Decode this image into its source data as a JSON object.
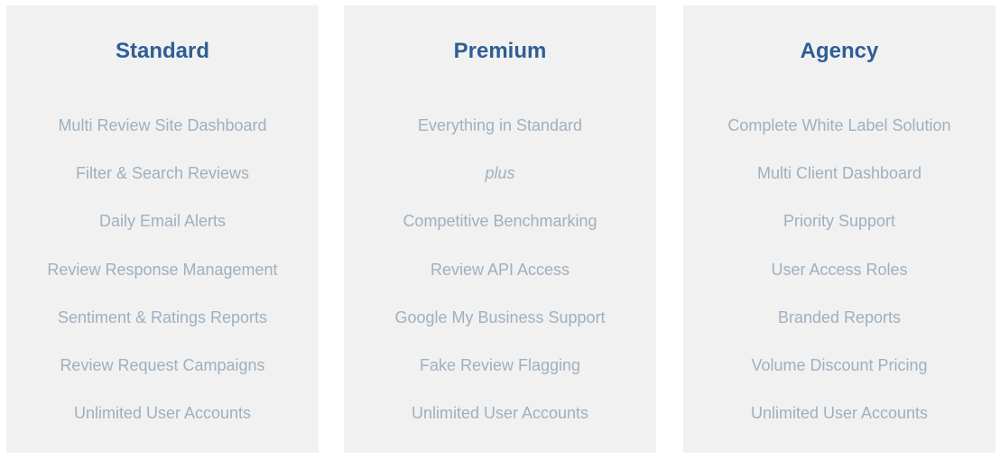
{
  "plans": [
    {
      "name": "Standard",
      "features": [
        {
          "text": "Multi Review Site Dashboard"
        },
        {
          "text": "Filter & Search Reviews"
        },
        {
          "text": "Daily Email Alerts"
        },
        {
          "text": "Review Response Management"
        },
        {
          "text": "Sentiment & Ratings Reports"
        },
        {
          "text": "Review Request Campaigns"
        },
        {
          "text": "Unlimited User Accounts"
        }
      ]
    },
    {
      "name": "Premium",
      "features": [
        {
          "text": "Everything in Standard"
        },
        {
          "text": "plus",
          "italic": true
        },
        {
          "text": "Competitive Benchmarking"
        },
        {
          "text": "Review API Access"
        },
        {
          "text": "Google My Business Support"
        },
        {
          "text": "Fake Review Flagging"
        },
        {
          "text": "Unlimited User Accounts"
        }
      ]
    },
    {
      "name": "Agency",
      "features": [
        {
          "text": "Complete White Label Solution"
        },
        {
          "text": "Multi Client Dashboard"
        },
        {
          "text": "Priority Support"
        },
        {
          "text": "User Access Roles"
        },
        {
          "text": "Branded Reports"
        },
        {
          "text": "Volume Discount Pricing"
        },
        {
          "text": "Unlimited User Accounts"
        }
      ]
    }
  ],
  "colors": {
    "title": "#2f5e95",
    "feature_text": "#9fb0bf",
    "panel_bg": "#f1f1f1"
  }
}
